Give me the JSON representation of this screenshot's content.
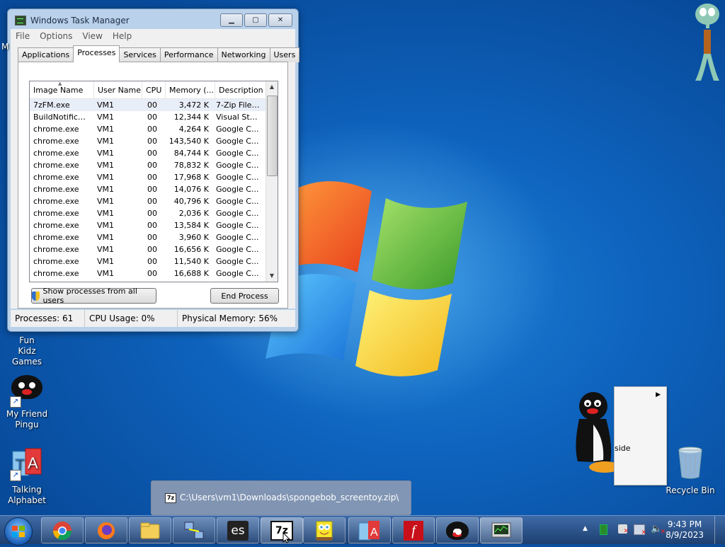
{
  "task_manager": {
    "title": "Windows Task Manager",
    "menu": [
      "File",
      "Options",
      "View",
      "Help"
    ],
    "tabs": [
      "Applications",
      "Processes",
      "Services",
      "Performance",
      "Networking",
      "Users"
    ],
    "active_tab": "Processes",
    "columns": [
      "Image Name",
      "User Name",
      "CPU",
      "Memory (...",
      "Description"
    ],
    "processes": [
      {
        "image": "7zFM.exe",
        "user": "VM1",
        "cpu": "00",
        "memory": "3,472 K",
        "description": "7-Zip File ..."
      },
      {
        "image": "BuildNotificati...",
        "user": "VM1",
        "cpu": "00",
        "memory": "12,344 K",
        "description": "Visual Stu..."
      },
      {
        "image": "chrome.exe",
        "user": "VM1",
        "cpu": "00",
        "memory": "4,264 K",
        "description": "Google C..."
      },
      {
        "image": "chrome.exe",
        "user": "VM1",
        "cpu": "00",
        "memory": "143,540 K",
        "description": "Google C..."
      },
      {
        "image": "chrome.exe",
        "user": "VM1",
        "cpu": "00",
        "memory": "84,744 K",
        "description": "Google C..."
      },
      {
        "image": "chrome.exe",
        "user": "VM1",
        "cpu": "00",
        "memory": "78,832 K",
        "description": "Google C..."
      },
      {
        "image": "chrome.exe",
        "user": "VM1",
        "cpu": "00",
        "memory": "17,968 K",
        "description": "Google C..."
      },
      {
        "image": "chrome.exe",
        "user": "VM1",
        "cpu": "00",
        "memory": "14,076 K",
        "description": "Google C..."
      },
      {
        "image": "chrome.exe",
        "user": "VM1",
        "cpu": "00",
        "memory": "40,796 K",
        "description": "Google C..."
      },
      {
        "image": "chrome.exe",
        "user": "VM1",
        "cpu": "00",
        "memory": "2,036 K",
        "description": "Google C..."
      },
      {
        "image": "chrome.exe",
        "user": "VM1",
        "cpu": "00",
        "memory": "13,584 K",
        "description": "Google C..."
      },
      {
        "image": "chrome.exe",
        "user": "VM1",
        "cpu": "00",
        "memory": "3,960 K",
        "description": "Google C..."
      },
      {
        "image": "chrome.exe",
        "user": "VM1",
        "cpu": "00",
        "memory": "16,656 K",
        "description": "Google C..."
      },
      {
        "image": "chrome.exe",
        "user": "VM1",
        "cpu": "00",
        "memory": "11,540 K",
        "description": "Google C..."
      },
      {
        "image": "chrome.exe",
        "user": "VM1",
        "cpu": "00",
        "memory": "16,688 K",
        "description": "Google C..."
      }
    ],
    "show_all_label": "Show processes from all users",
    "end_process_label": "End Process",
    "status": {
      "processes": "Processes: 61",
      "cpu": "CPU Usage: 0%",
      "memory": "Physical Memory: 56%"
    }
  },
  "desktop": {
    "partial_label": "M",
    "icons": [
      {
        "label": "Fun Kidz Games"
      },
      {
        "label": "My Friend Pingu"
      },
      {
        "label": "Talking Alphabet"
      },
      {
        "label": "Recycle Bin"
      }
    ],
    "context_menu_fragment": "side"
  },
  "thumbnail_tooltip": {
    "path": "C:\\Users\\vm1\\Downloads\\spongebob_screentoy.zip\\"
  },
  "taskbar": {
    "apps": [
      "chrome-icon",
      "firefox-icon",
      "explorer-icon",
      "network-icon",
      "es-icon",
      "7zip-icon",
      "spongebob-icon",
      "talking-alphabet-icon",
      "flash-icon",
      "pingu-icon",
      "task-manager-icon"
    ],
    "time": "9:43 PM",
    "date": "8/9/2023"
  },
  "colors": {
    "desktop_blue": "#0e63bd",
    "taskbar": "#1d3f70",
    "window_frame": "#b9d1ea"
  }
}
